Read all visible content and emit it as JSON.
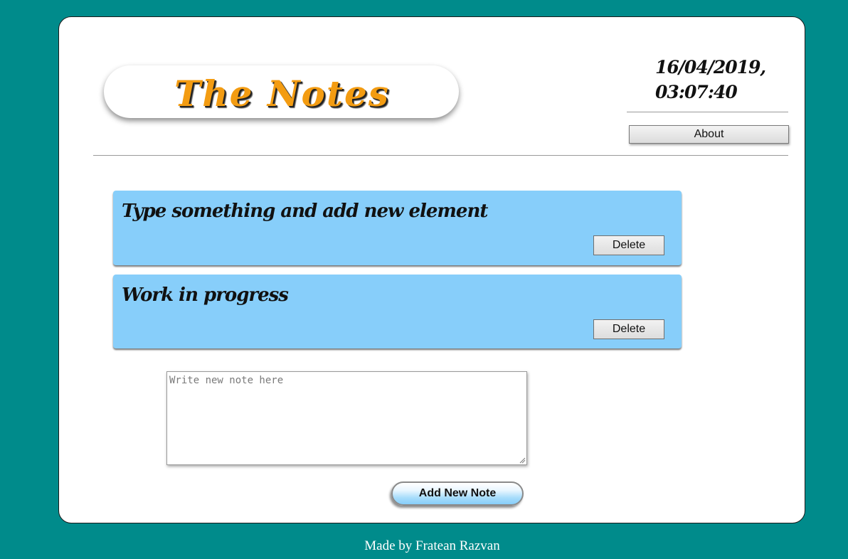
{
  "header": {
    "title": "The Notes",
    "datetime_line1": "16/04/2019,",
    "datetime_line2": "03:07:40",
    "about_label": "About"
  },
  "notes": [
    {
      "text": "Type something and add new element",
      "delete_label": "Delete"
    },
    {
      "text": "Work in progress",
      "delete_label": "Delete"
    }
  ],
  "composer": {
    "placeholder": "Write new note here",
    "value": "",
    "add_label": "Add New Note"
  },
  "footer": {
    "credit": "Made by Fratean Razvan"
  },
  "colors": {
    "page_background": "#008b8b",
    "note_background": "#87cefa",
    "title_color": "#f39c12"
  }
}
